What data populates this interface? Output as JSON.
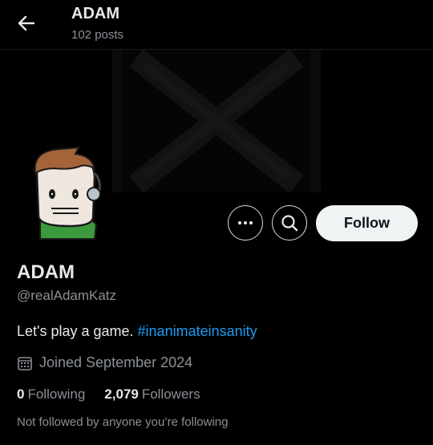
{
  "header": {
    "title": "ADAM",
    "posts_count": "102 posts"
  },
  "profile": {
    "display_name": "ADAM",
    "handle": "@realAdamKatz",
    "bio_text": "Let's play a game. ",
    "bio_hashtag": "#inanimateinsanity",
    "joined": "Joined September 2024",
    "following_count": "0",
    "following_label": "Following",
    "followers_count": "2,079",
    "followers_label": "Followers",
    "not_followed_note": "Not followed by anyone you’re following"
  },
  "actions": {
    "follow_label": "Follow",
    "more_icon": "more-icon",
    "search_icon": "search-icon"
  },
  "colors": {
    "background": "#000000",
    "accent": "#1d9bf0",
    "secondary_text": "#8b9096",
    "primary_text": "#e7e9ea",
    "follow_button": "#eff3f4"
  }
}
